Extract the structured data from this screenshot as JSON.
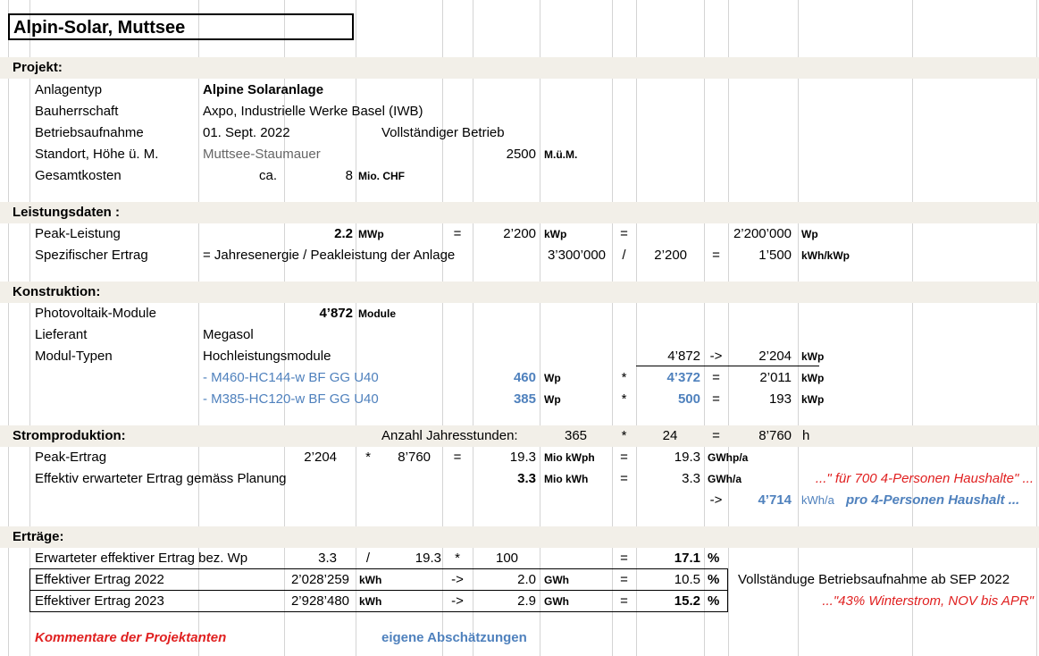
{
  "title": "Alpin-Solar,   Muttsee",
  "projekt": {
    "header": "Projekt:",
    "anlagentyp_label": "Anlagentyp",
    "anlagentyp_value": "Alpine Solaranlage",
    "bauherrschaft_label": "Bauherrschaft",
    "bauherrschaft_value": "Axpo,   Industrielle Werke Basel (IWB)",
    "betriebsaufnahme_label": "Betriebsaufnahme",
    "betriebsaufnahme_value": "01. Sept. 2022",
    "betriebsaufnahme_note": "Vollständiger Betrieb",
    "standort_label": "Standort,  Höhe ü. M.",
    "standort_value": "Muttsee-Staumauer",
    "hoehe_value": "2500",
    "hoehe_unit": "M.ü.M.",
    "gesamtkosten_label": "Gesamtkosten",
    "gesamtkosten_ca": "ca.",
    "gesamtkosten_value": "8",
    "gesamtkosten_unit": "Mio.  CHF"
  },
  "leistung": {
    "header": "Leistungsdaten :",
    "peak_label": "Peak-Leistung",
    "peak_value": "2.2",
    "peak_unit": "MWp",
    "eq1": "=",
    "peak_kwp": "2’200",
    "kwp_unit": "kWp",
    "eq2": "=",
    "peak_wp": "2’200’000",
    "wp_unit": "Wp",
    "spez_label": "Spezifischer Ertrag",
    "spez_formula": "=  Jahresenergie / Peakleistung der Anlage",
    "spez_energy": "3’300’000",
    "spez_div": "/",
    "spez_kwp": "2’200",
    "spez_eq": "=",
    "spez_value": "1’500",
    "spez_unit": "kWh/kWp"
  },
  "konstruktion": {
    "header": "Konstruktion:",
    "pv_label": "Photovoltaik-Module",
    "pv_value": "4’872",
    "pv_unit": "Module",
    "lieferant_label": "Lieferant",
    "lieferant_value": "Megasol",
    "typen_label": "Modul-Typen",
    "typen_value": "Hochleistungsmodule",
    "typen_count": "4’872",
    "typen_arrow": "->",
    "typen_kwp": "2’204",
    "typen_unit": "kWp",
    "modules": [
      {
        "name": "-   M460-HC144-w BF GG U40",
        "wp": "460",
        "wp_unit": "Wp",
        "mul": "*",
        "count": "4’372",
        "eq": "=",
        "kwp": "2’011",
        "kwp_unit": "kWp"
      },
      {
        "name": "-   M385-HC120-w BF GG U40",
        "wp": "385",
        "wp_unit": "Wp",
        "mul": "*",
        "count": "500",
        "eq": "=",
        "kwp": "193",
        "kwp_unit": "kWp"
      }
    ]
  },
  "strom": {
    "header": "Stromproduktion:",
    "jahresstunden_label": "Anzahl Jahresstunden:",
    "days": "365",
    "mul": "*",
    "hours": "24",
    "eq": "=",
    "total_hours": "8’760",
    "h_unit": "h",
    "peak_label": "Peak-Ertrag",
    "peak_kwp": "2’204",
    "peak_mul": "*",
    "peak_hours": "8’760",
    "peak_eq": "=",
    "peak_value": "19.3",
    "peak_unit": "Mio kWph",
    "peak_eq2": "=",
    "peak_gwh": "19.3",
    "peak_gwh_unit": "GWhp/a",
    "eff_label": "Effektiv erwarteter Ertrag  gemäss Planung",
    "eff_value": "3.3",
    "eff_unit": "Mio kWh",
    "eff_eq": "=",
    "eff_gwh": "3.3",
    "eff_gwh_unit": "GWh/a",
    "eff_comment": "...\" für 700   4-Personen Haushalte\" ...",
    "hh_arrow": "->",
    "hh_value": "4’714",
    "hh_unit": "kWh/a",
    "hh_text": "pro 4-Personen Haushalt ..."
  },
  "ertraege": {
    "header": "Erträge:",
    "bez_label": "Erwarteter effektiver Ertrag bez. Wp",
    "bez_a": "3.3",
    "bez_div": "/",
    "bez_b": "19.3",
    "bez_mul": "*",
    "bez_c": "100",
    "bez_eq": "=",
    "bez_value": "17.1",
    "bez_unit": "%",
    "y2022_label": "Effektiver Ertrag  2022",
    "y2022_kwh": "2’028’259",
    "y2022_kwh_unit": "kWh",
    "y2022_arrow": "->",
    "y2022_gwh": "2.0",
    "y2022_gwh_unit": "GWh",
    "y2022_eq": "=",
    "y2022_pct": "10.5",
    "y2022_pct_unit": "%",
    "y2022_note": "Vollständuge Betriebsaufnahme ab SEP 2022",
    "y2023_label": "Effektiver Ertrag  2023",
    "y2023_kwh": "2’928’480",
    "y2023_kwh_unit": "kWh",
    "y2023_arrow": "->",
    "y2023_gwh": "2.9",
    "y2023_gwh_unit": "GWh",
    "y2023_eq": "=",
    "y2023_pct": "15.2",
    "y2023_pct_unit": "%",
    "y2023_note": "...\"43% Winterstrom, NOV bis APR\""
  },
  "footer": {
    "kommentare": "Kommentare der Projektanten",
    "eigene": "eigene Abschätzungen"
  },
  "colors": {
    "band": "#f2efe8",
    "blue": "#4f81bd",
    "red": "#e02020"
  }
}
